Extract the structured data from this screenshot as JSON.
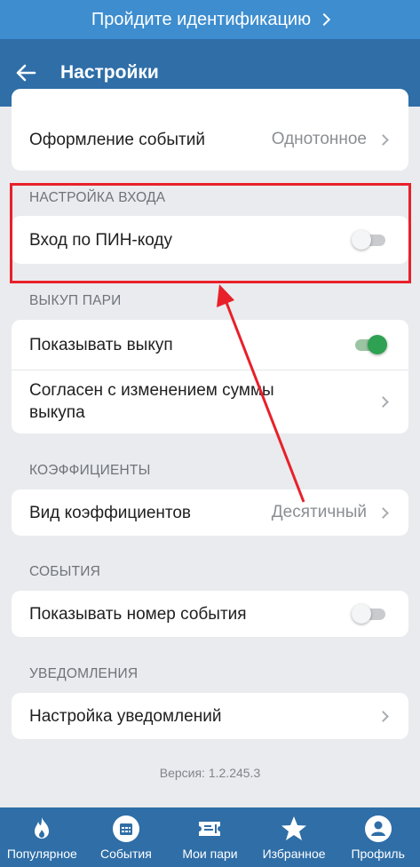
{
  "banner": {
    "text": "Пройдите идентификацию"
  },
  "header": {
    "title": "Настройки"
  },
  "sections": {
    "event_design": {
      "label": "Оформление событий",
      "value": "Однотонное"
    },
    "login": {
      "title": "НАСТРОЙКА ВХОДА",
      "pin_label": "Вход по ПИН-коду",
      "pin_enabled": false
    },
    "buyout": {
      "title": "ВЫКУП ПАРИ",
      "show_label": "Показывать выкуп",
      "show_enabled": true,
      "agree_label": "Согласен с изменением суммы выкупа"
    },
    "coefficients": {
      "title": "КОЭФФИЦИЕНТЫ",
      "view_label": "Вид коэффициентов",
      "view_value": "Десятичный"
    },
    "events": {
      "title": "СОБЫТИЯ",
      "show_number_label": "Показывать номер события",
      "show_number_enabled": false
    },
    "notifications": {
      "title": "УВЕДОМЛЕНИЯ",
      "settings_label": "Настройка уведомлений"
    }
  },
  "version": "Версия: 1.2.245.3",
  "nav": {
    "popular": "Популярное",
    "events": "События",
    "my_bets": "Мои пари",
    "favorites": "Избранное",
    "profile": "Профиль"
  },
  "colors": {
    "banner": "#3d8dcf",
    "appbar": "#2f6ea7",
    "toggle_on": "#2fa152",
    "annotation": "#e8202a",
    "background": "#e9ebee"
  },
  "icons": [
    "arrow-left-icon",
    "chevron-right-icon",
    "flame-icon",
    "calendar-icon",
    "ticket-icon",
    "star-icon",
    "user-icon"
  ]
}
